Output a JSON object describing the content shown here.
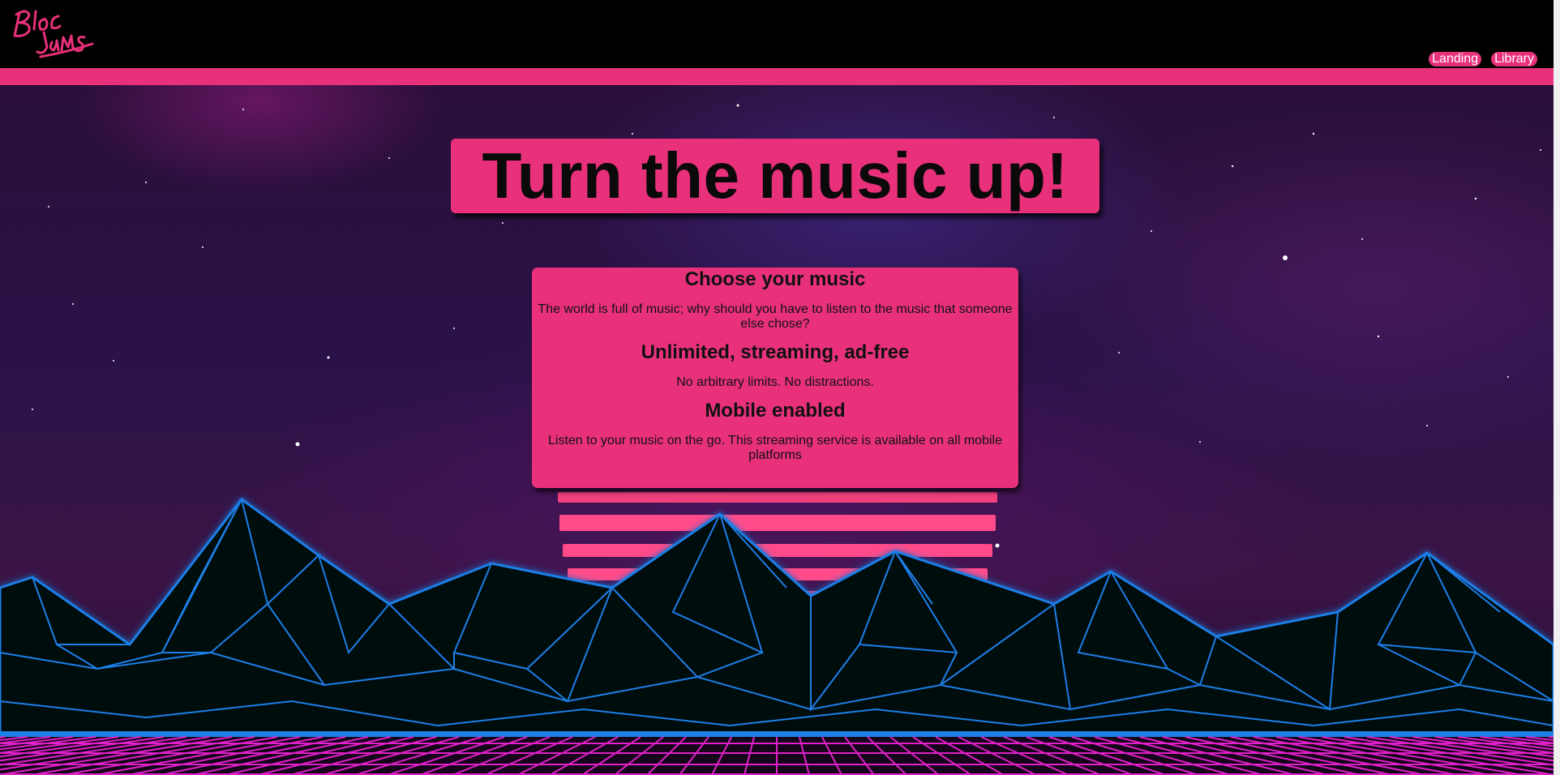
{
  "app": {
    "logo_text": "Bloc Jams"
  },
  "nav": {
    "items": [
      {
        "label": "Landing"
      },
      {
        "label": "Library"
      }
    ]
  },
  "hero": {
    "title": "Turn the music up!"
  },
  "selling_points": [
    {
      "title": "Choose your music",
      "description": "The world is full of music; why should you have to listen to the music that someone else chose?"
    },
    {
      "title": "Unlimited, streaming, ad-free",
      "description": "No arbitrary limits. No distractions."
    },
    {
      "title": "Mobile enabled",
      "description": "Listen to your music on the go. This streaming service is available on all mobile platforms"
    }
  ],
  "colors": {
    "accent": "#e8317a",
    "header_bg": "#000000",
    "mountain_wire": "#1e7fe6",
    "grid": "#e020c8"
  }
}
